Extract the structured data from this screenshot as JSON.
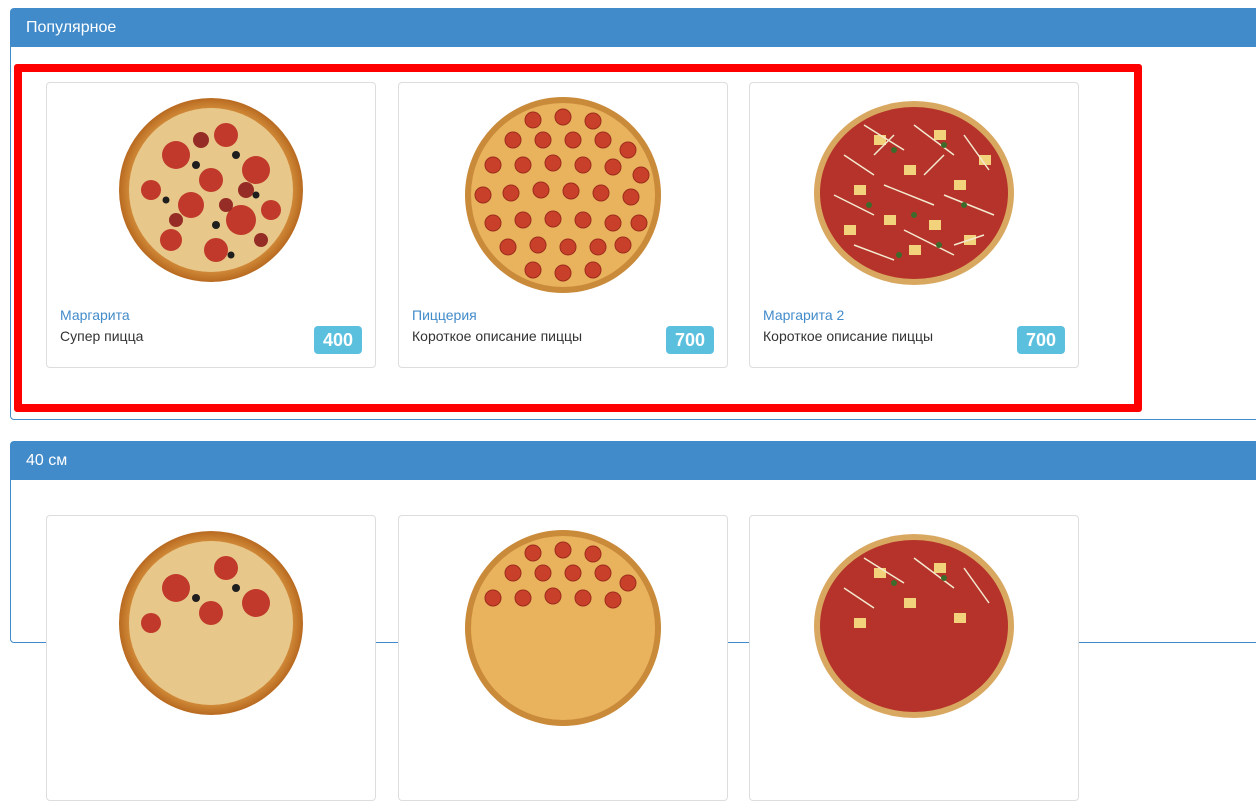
{
  "sections": [
    {
      "title": "Популярное",
      "items": [
        {
          "name": "Маргарита",
          "description": "Супер пицца",
          "price": "400",
          "image": "margherita-pizza"
        },
        {
          "name": "Пиццерия",
          "description": "Короткое описание пиццы",
          "price": "700",
          "image": "pepperoni-pizza"
        },
        {
          "name": "Маргарита 2",
          "description": "Короткое описание пиццы",
          "price": "700",
          "image": "cheese-pineapple-pizza"
        }
      ]
    },
    {
      "title": "40 см",
      "items": [
        {
          "image": "margherita-pizza"
        },
        {
          "image": "pepperoni-pizza"
        },
        {
          "image": "cheese-pineapple-pizza"
        }
      ]
    }
  ],
  "colors": {
    "header": "#428bca",
    "badge": "#5bc0de",
    "highlight": "#ff0000"
  }
}
